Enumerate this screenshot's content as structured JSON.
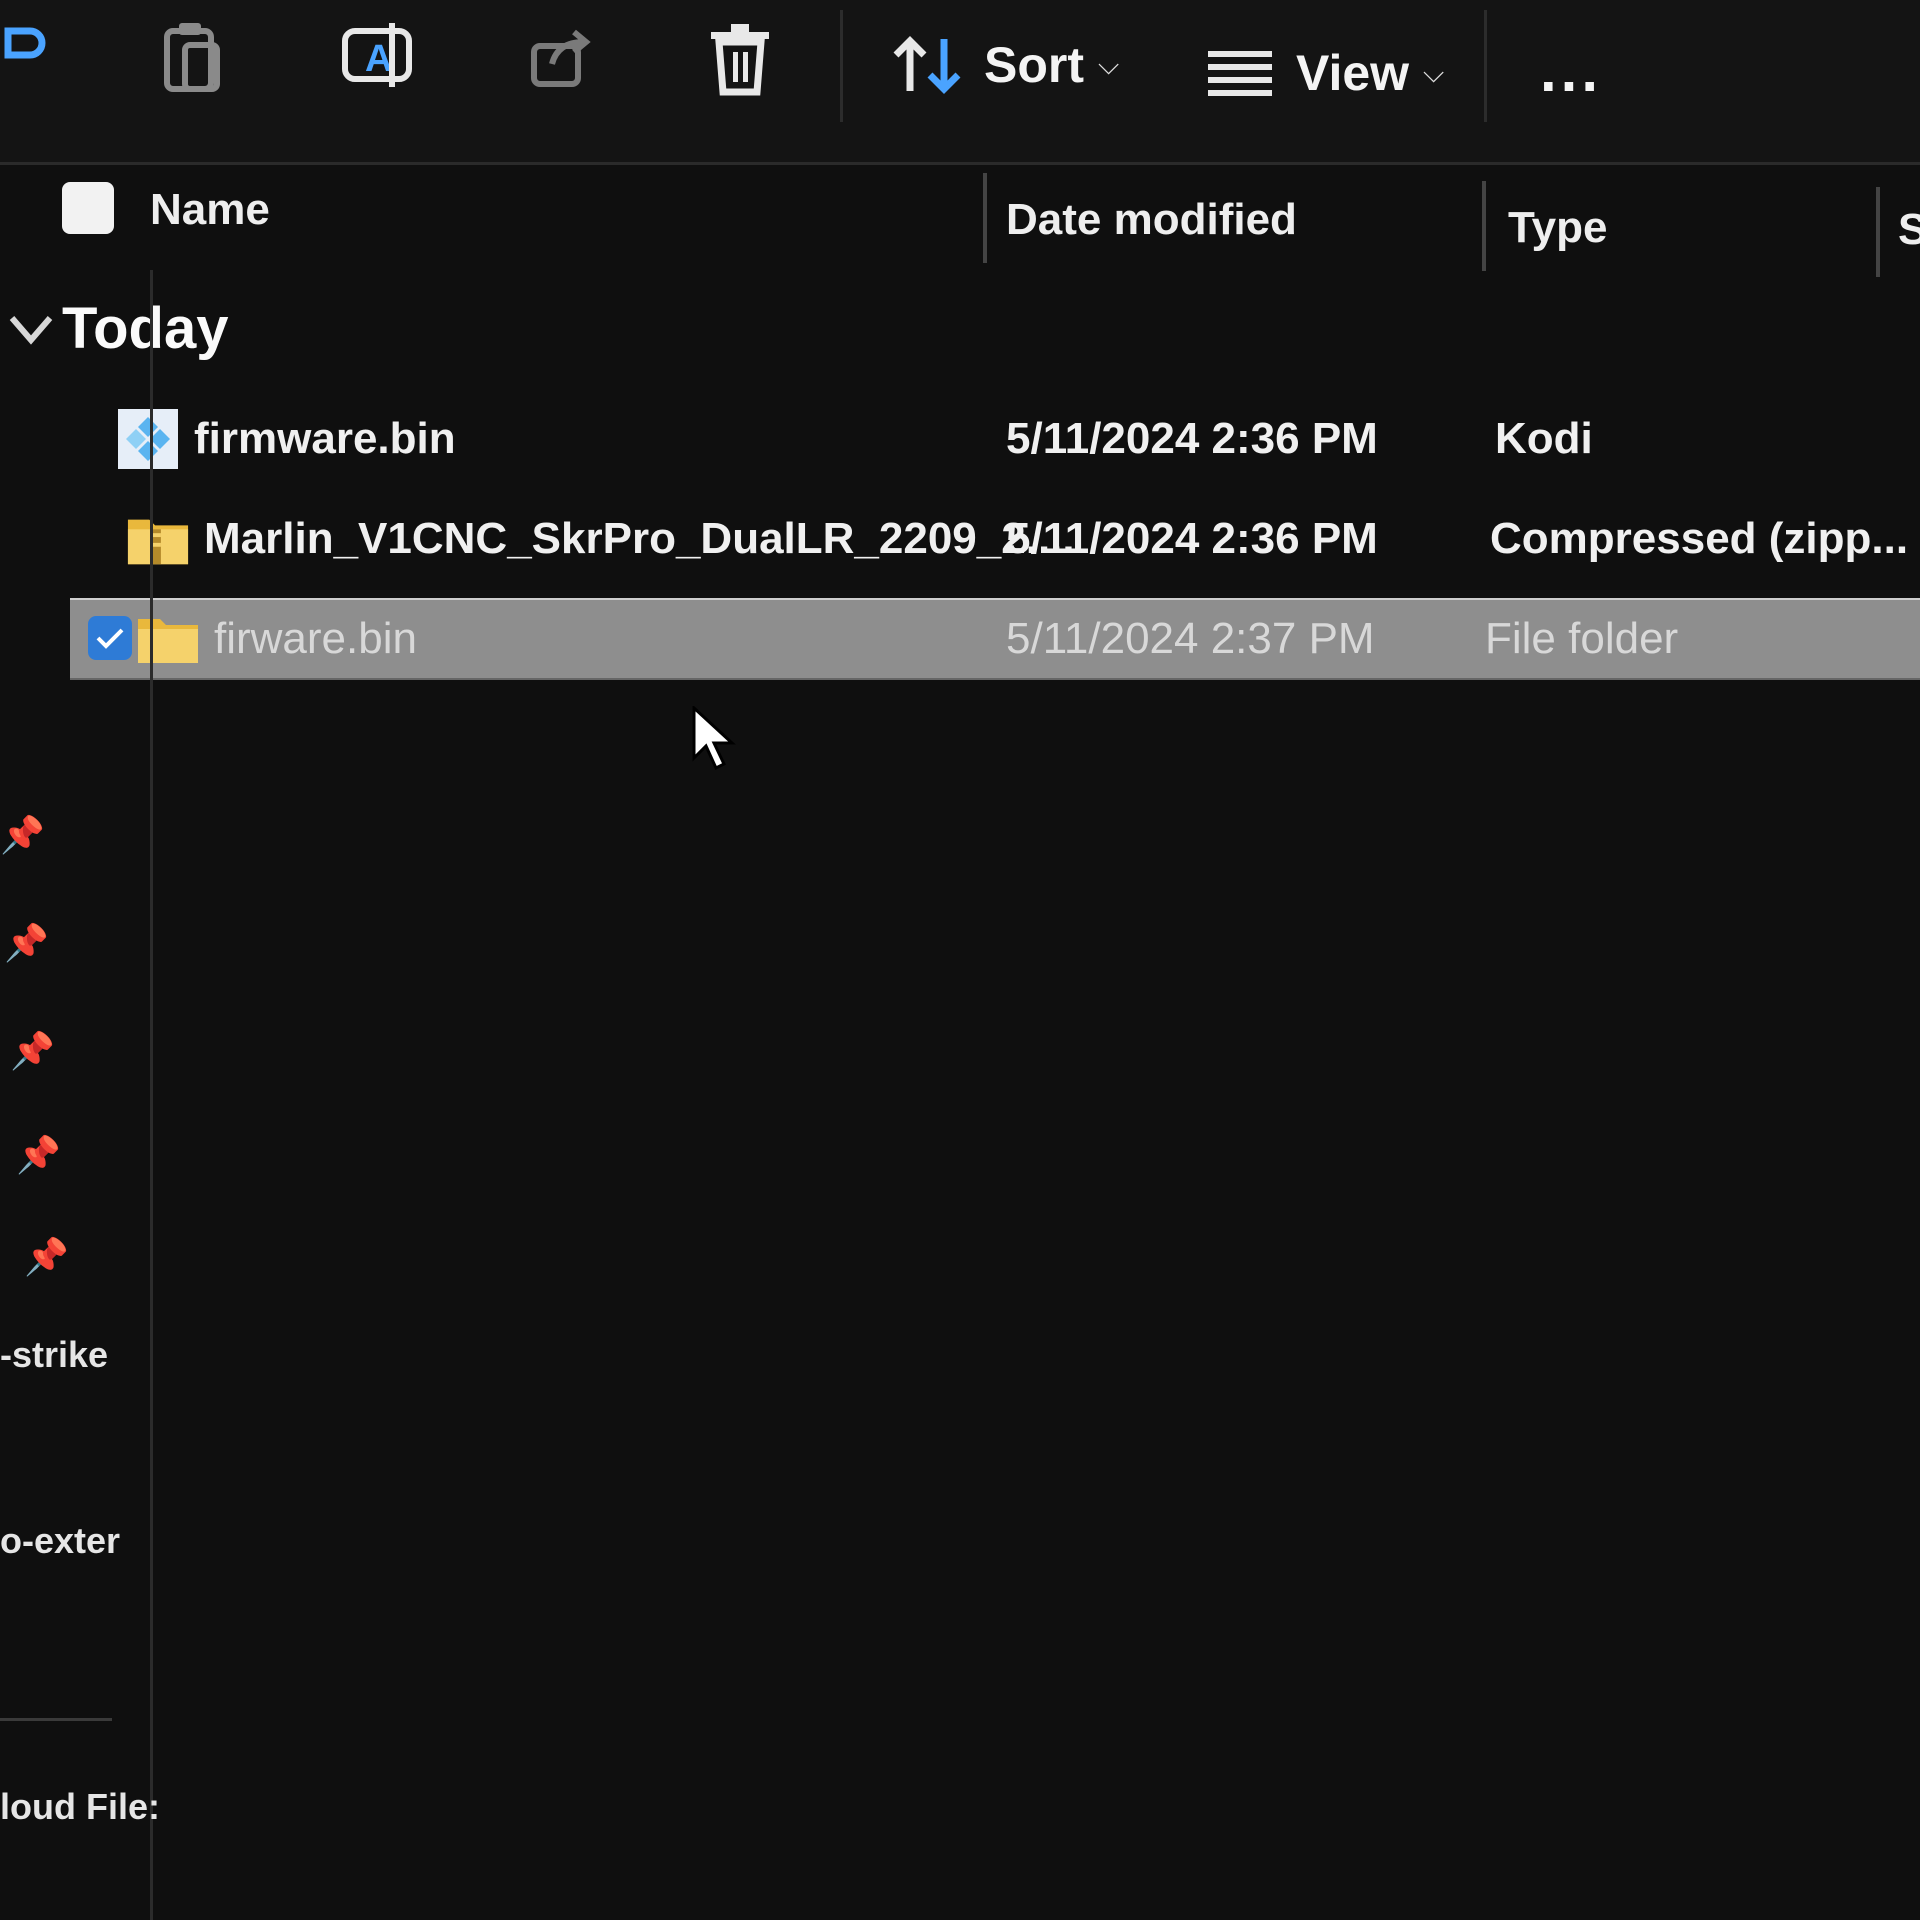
{
  "toolbar": {
    "buttons": [
      {
        "name": "paste-icon"
      },
      {
        "name": "copy-icon"
      },
      {
        "name": "rename-icon"
      },
      {
        "name": "share-icon"
      },
      {
        "name": "delete-icon"
      }
    ],
    "sort_label": "Sort",
    "view_label": "View",
    "more_label": "..."
  },
  "columns": {
    "name": "Name",
    "date_modified": "Date modified",
    "type": "Type",
    "size_partial": "S"
  },
  "group": {
    "title": "Today"
  },
  "files": [
    {
      "name": "firmware.bin",
      "date": "5/11/2024 2:36 PM",
      "type": "Kodi",
      "icon": "kodi-file-icon",
      "selected": false
    },
    {
      "name": "Marlin_V1CNC_SkrPro_DualLR_2209_2....",
      "date": "5/11/2024 2:36 PM",
      "type": "Compressed (zipp...",
      "icon": "zip-folder-icon",
      "selected": false
    },
    {
      "name": "firware.bin",
      "date": "5/11/2024 2:37 PM",
      "type": "File folder",
      "icon": "folder-icon",
      "selected": true
    }
  ],
  "sidebar": {
    "pin_icon": "pin-icon",
    "items": [
      "-strike",
      "o-exter"
    ],
    "footer": "loud File:"
  },
  "colors": {
    "background": "#0f0f0f",
    "selection": "#8e8e8e",
    "folder": "#f2c94c",
    "checkbox_accent": "#2e7bd6"
  }
}
